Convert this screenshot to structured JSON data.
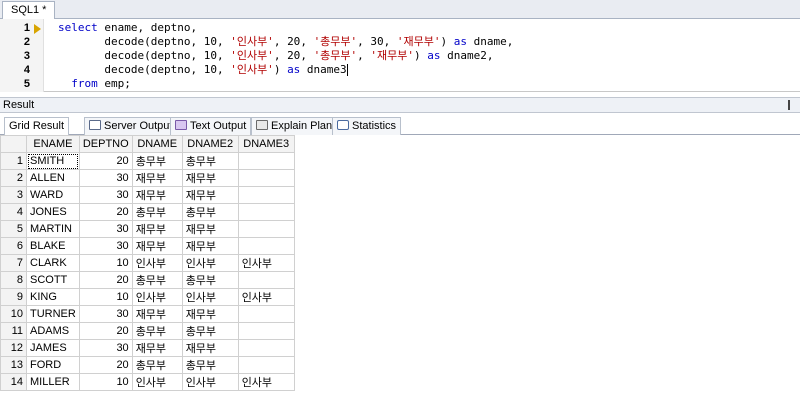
{
  "editor": {
    "tab_label": "SQL1 *",
    "lines": [
      {
        "n": "1",
        "tokens": [
          [
            "kw",
            "select"
          ],
          [
            "t",
            " ename, deptno,"
          ]
        ]
      },
      {
        "n": "2",
        "tokens": [
          [
            "t",
            "       decode(deptno, "
          ],
          [
            "num",
            "10"
          ],
          [
            "t",
            ", "
          ],
          [
            "str",
            "'인사부'"
          ],
          [
            "t",
            ", "
          ],
          [
            "num",
            "20"
          ],
          [
            "t",
            ", "
          ],
          [
            "str",
            "'총무부'"
          ],
          [
            "t",
            ", "
          ],
          [
            "num",
            "30"
          ],
          [
            "t",
            ", "
          ],
          [
            "str",
            "'재무부'"
          ],
          [
            "t",
            ") "
          ],
          [
            "kw",
            "as"
          ],
          [
            "t",
            " dname,"
          ]
        ]
      },
      {
        "n": "3",
        "tokens": [
          [
            "t",
            "       decode(deptno, "
          ],
          [
            "num",
            "10"
          ],
          [
            "t",
            ", "
          ],
          [
            "str",
            "'인사부'"
          ],
          [
            "t",
            ", "
          ],
          [
            "num",
            "20"
          ],
          [
            "t",
            ", "
          ],
          [
            "str",
            "'총무부'"
          ],
          [
            "t",
            ", "
          ],
          [
            "str",
            "'재무부'"
          ],
          [
            "t",
            ") "
          ],
          [
            "kw",
            "as"
          ],
          [
            "t",
            " dname2,"
          ]
        ]
      },
      {
        "n": "4",
        "tokens": [
          [
            "t",
            "       decode(deptno, "
          ],
          [
            "num",
            "10"
          ],
          [
            "t",
            ", "
          ],
          [
            "str",
            "'인사부'"
          ],
          [
            "t",
            ") "
          ],
          [
            "kw",
            "as"
          ],
          [
            "t",
            " dname3"
          ]
        ]
      },
      {
        "n": "5",
        "tokens": [
          [
            "t",
            "  "
          ],
          [
            "kw",
            "from"
          ],
          [
            "t",
            " emp;"
          ]
        ]
      }
    ]
  },
  "result": {
    "title": "Result",
    "tabs": [
      {
        "label": "Grid Result",
        "icon": "grid-icon"
      },
      {
        "label": "Server Output",
        "icon": "server-output-icon"
      },
      {
        "label": "Text Output",
        "icon": "text-output-icon"
      },
      {
        "label": "Explain Plan",
        "icon": "explain-plan-icon"
      },
      {
        "label": "Statistics",
        "icon": "statistics-icon"
      }
    ],
    "columns": [
      "ENAME",
      "DEPTNO",
      "DNAME",
      "DNAME2",
      "DNAME3"
    ],
    "rows": [
      [
        "1",
        "SMITH",
        "20",
        "총무부",
        "총무부",
        ""
      ],
      [
        "2",
        "ALLEN",
        "30",
        "재무부",
        "재무부",
        ""
      ],
      [
        "3",
        "WARD",
        "30",
        "재무부",
        "재무부",
        ""
      ],
      [
        "4",
        "JONES",
        "20",
        "총무부",
        "총무부",
        ""
      ],
      [
        "5",
        "MARTIN",
        "30",
        "재무부",
        "재무부",
        ""
      ],
      [
        "6",
        "BLAKE",
        "30",
        "재무부",
        "재무부",
        ""
      ],
      [
        "7",
        "CLARK",
        "10",
        "인사부",
        "인사부",
        "인사부"
      ],
      [
        "8",
        "SCOTT",
        "20",
        "총무부",
        "총무부",
        ""
      ],
      [
        "9",
        "KING",
        "10",
        "인사부",
        "인사부",
        "인사부"
      ],
      [
        "10",
        "TURNER",
        "30",
        "재무부",
        "재무부",
        ""
      ],
      [
        "11",
        "ADAMS",
        "20",
        "총무부",
        "총무부",
        ""
      ],
      [
        "12",
        "JAMES",
        "30",
        "재무부",
        "재무부",
        ""
      ],
      [
        "13",
        "FORD",
        "20",
        "총무부",
        "총무부",
        ""
      ],
      [
        "14",
        "MILLER",
        "10",
        "인사부",
        "인사부",
        "인사부"
      ]
    ]
  }
}
